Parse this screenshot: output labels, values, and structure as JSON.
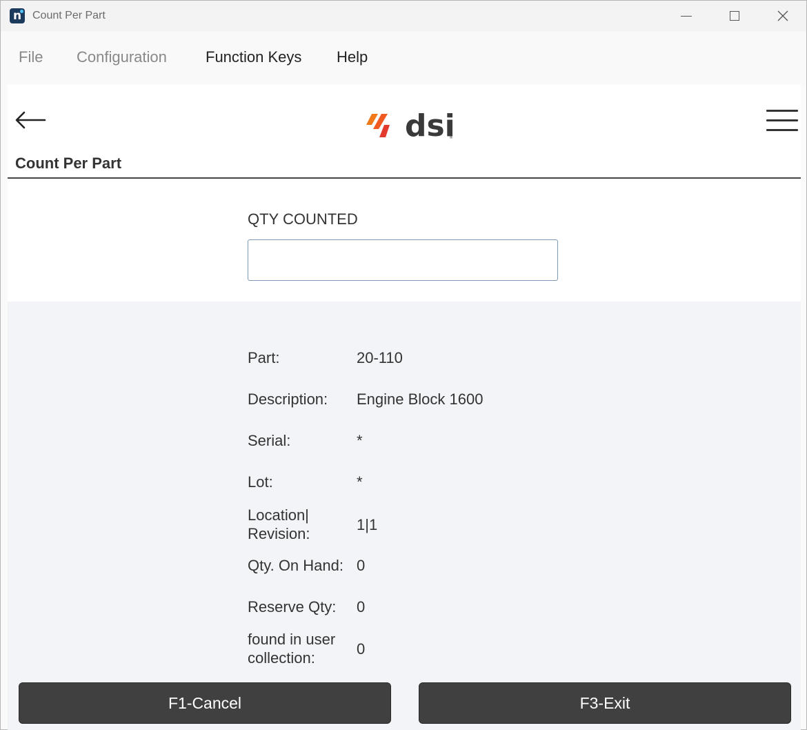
{
  "window": {
    "title": "Count Per Part",
    "app_icon_letter": "n"
  },
  "menu": {
    "file": "File",
    "configuration": "Configuration",
    "function_keys": "Function Keys",
    "help": "Help"
  },
  "header": {
    "logo_text": "dsi",
    "logo_mark": "®",
    "page_title": "Count Per Part"
  },
  "form": {
    "qty_label": "QTY COUNTED",
    "qty_value": "",
    "qty_placeholder": ""
  },
  "details": [
    {
      "label": "Part:",
      "value": "20-110"
    },
    {
      "label": "Description:",
      "value": "Engine Block 1600"
    },
    {
      "label": "Serial:",
      "value": "*"
    },
    {
      "label": "Lot:",
      "value": "*"
    },
    {
      "label": "Location|\nRevision:",
      "value": "1|1"
    },
    {
      "label": "Qty. On Hand:",
      "value": "0"
    },
    {
      "label": "Reserve Qty:",
      "value": "0"
    },
    {
      "label": "found in user\ncollection:",
      "value": "0"
    }
  ],
  "buttons": {
    "cancel": "F1-Cancel",
    "exit": "F3-Exit"
  },
  "colors": {
    "button_bg": "#404040",
    "panel_bg": "#f3f4f8",
    "logo_orange": "#f07a1a",
    "logo_red": "#e23b2e",
    "logo_text": "#3a3a3a"
  },
  "icons": {
    "back": "arrow-left-icon",
    "menu": "hamburger-icon",
    "minimize": "minimize-icon",
    "maximize": "maximize-icon",
    "close": "close-icon"
  }
}
